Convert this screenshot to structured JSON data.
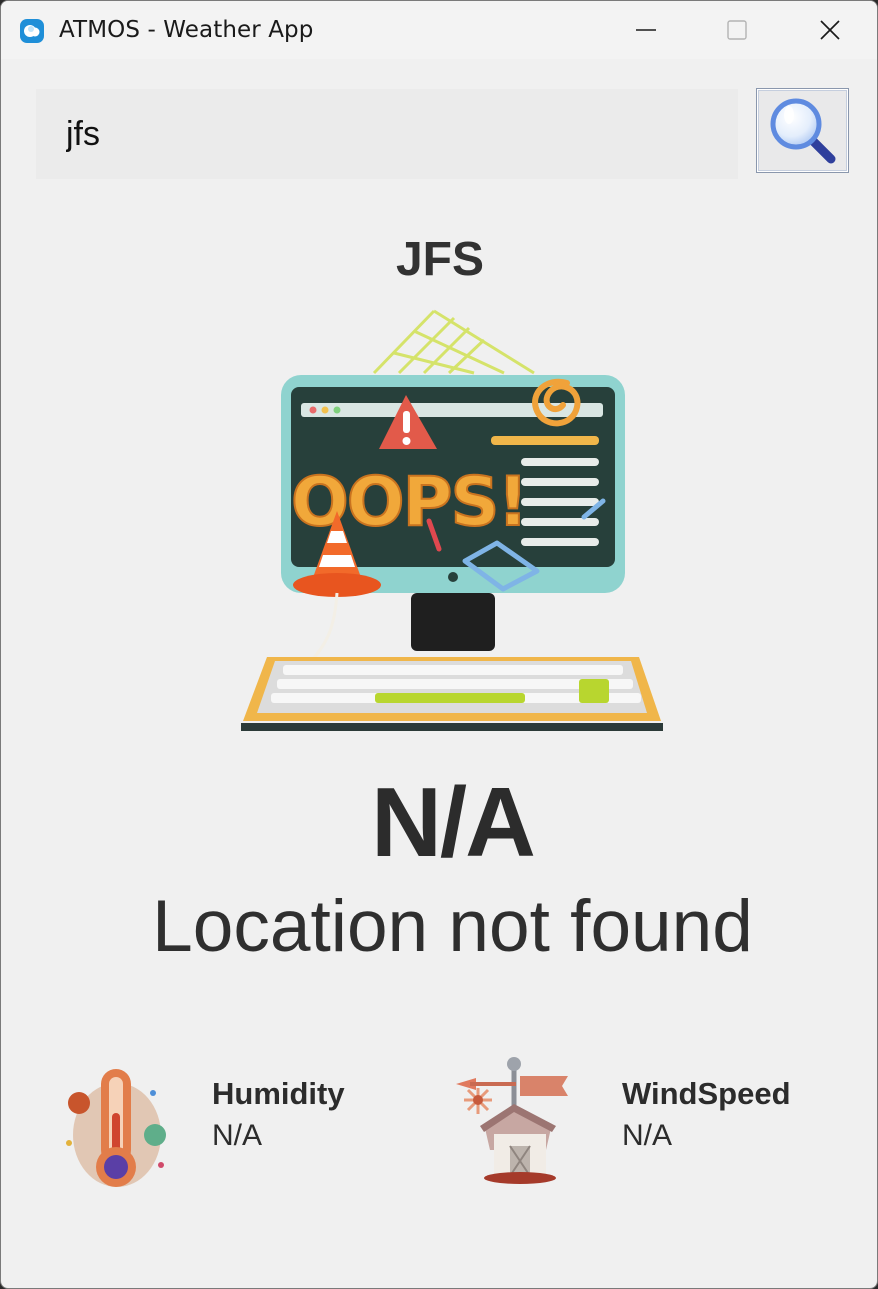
{
  "window": {
    "title": "ATMOS - Weather App",
    "accent": "#1f8fd8"
  },
  "search": {
    "value": "jfs",
    "button_icon": "magnifier-icon"
  },
  "weather": {
    "city": "JFS",
    "temperature": "N/A",
    "description": "Location not found",
    "illustration_text": "OOPS!",
    "illustration_icon": "oops-computer-error-image"
  },
  "stats": {
    "humidity": {
      "label": "Humidity",
      "value": "N/A",
      "icon": "thermometer-icon"
    },
    "windspeed": {
      "label": "WindSpeed",
      "value": "N/A",
      "icon": "weather-vane-icon"
    }
  }
}
